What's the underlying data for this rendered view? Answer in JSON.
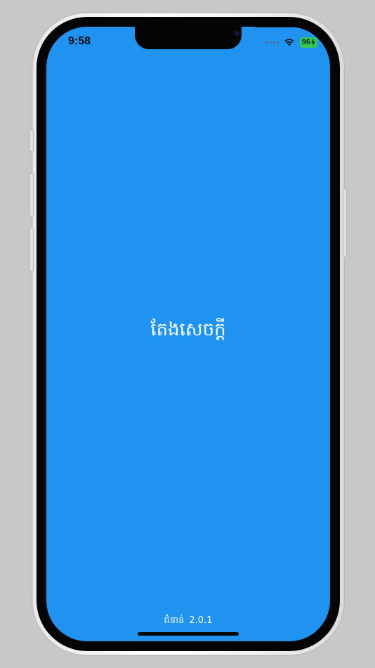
{
  "status_bar": {
    "time": "9:58",
    "battery_level": "96",
    "icons": [
      "cellular-signal-icon",
      "wifi-icon",
      "battery-charging-icon"
    ]
  },
  "splash": {
    "app_name": "តែងសេចក្តី",
    "version_label": "ជំនាន់",
    "version_number": "2.0.1"
  },
  "colors": {
    "background": "#2093f0",
    "text": "#ffffff",
    "battery": "#34c759"
  }
}
